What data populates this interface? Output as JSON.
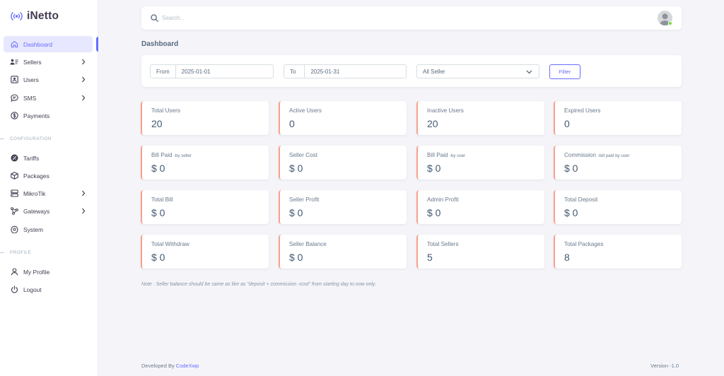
{
  "brand": {
    "name": "iNetto",
    "icon": "broadcast-icon",
    "accent": "#696cff"
  },
  "menu": {
    "dashboard": "Dashboard",
    "sellers": "Sellers",
    "users": "Users",
    "sms": "SMS",
    "payments": "Payments",
    "configuration_header": "CONFIGURATION",
    "tariffs": "Tariffs",
    "packages": "Packages",
    "mikrotik": "MikroTik",
    "gateways": "Gateways",
    "system": "System",
    "profile_header": "PROFILE",
    "my_profile": "My Profile",
    "logout": "Logout"
  },
  "search": {
    "placeholder": "Search..."
  },
  "page": {
    "title": "Dashboard"
  },
  "filter": {
    "from_label": "From",
    "from_value": "2025-01-01",
    "to_label": "To",
    "to_value": "2025-01-31",
    "seller_select": "All Seller",
    "button": "Filter"
  },
  "stats": [
    {
      "label": "Total Users",
      "sub": "",
      "value": "20"
    },
    {
      "label": "Active Users",
      "sub": "",
      "value": "0"
    },
    {
      "label": "Inactive Users",
      "sub": "",
      "value": "20"
    },
    {
      "label": "Expired Users",
      "sub": "",
      "value": "0"
    },
    {
      "label": "Bill Paid",
      "sub": "-by seller",
      "value": "$ 0"
    },
    {
      "label": "Seller Cost",
      "sub": "",
      "value": "$ 0"
    },
    {
      "label": "Bill Paid",
      "sub": "-by user",
      "value": "$ 0"
    },
    {
      "label": "Commission",
      "sub": "-bill paid by user",
      "value": "$ 0"
    },
    {
      "label": "Total Bill",
      "sub": "",
      "value": "$ 0"
    },
    {
      "label": "Seller Profit",
      "sub": "",
      "value": "$ 0"
    },
    {
      "label": "Admin Profit",
      "sub": "",
      "value": "$ 0"
    },
    {
      "label": "Total Deposit",
      "sub": "",
      "value": "$ 0"
    },
    {
      "label": "Total Withdraw",
      "sub": "",
      "value": "$ 0"
    },
    {
      "label": "Seller Balance",
      "sub": "",
      "value": "$ 0"
    },
    {
      "label": "Total Sellers",
      "sub": "",
      "value": "5"
    },
    {
      "label": "Total Packages",
      "sub": "",
      "value": "8"
    }
  ],
  "note": "Note : Seller balance should be same as like as \"deposit + commission -cost\" from starting day to now only.",
  "footer": {
    "developed_by": "Developed By",
    "developer": "CodeXwp",
    "version": "Version -1.0"
  }
}
